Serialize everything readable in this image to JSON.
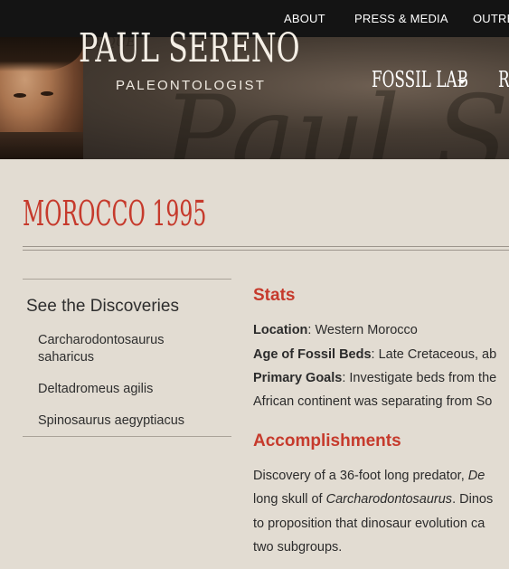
{
  "topnav": {
    "items": [
      "ABOUT",
      "PRESS & MEDIA",
      "OUTRE"
    ]
  },
  "header": {
    "site_name": "PAUL SERENO",
    "site_subtitle": "PALEONTOLOGIST",
    "nav_fossil_lab": "FOSSIL LAB",
    "nav_next_partial": "RI"
  },
  "page": {
    "title": "MOROCCO 1995"
  },
  "sidebar": {
    "heading": "See the Discoveries",
    "items": [
      "Carcharodontosaurus saharicus",
      "Deltadromeus agilis",
      "Spinosaurus aegyptiacus"
    ]
  },
  "stats": {
    "heading": "Stats",
    "location_label": "Location",
    "location_value": ": Western Morocco",
    "age_label": "Age of Fossil Beds",
    "age_value": ": Late Cretaceous, ab",
    "goals_label": "Primary Goals",
    "goals_value": ": Investigate beds from the",
    "goals_line2": "African continent was separating from So"
  },
  "accomplishments": {
    "heading": "Accomplishments",
    "line1_pre": "Discovery of a 36-foot long predator, ",
    "line1_italic": "De",
    "line2_pre": "long skull of ",
    "line2_italic": "Carcharodontosaurus",
    "line2_post": ". Dinos",
    "line3": "to proposition that dinosaur evolution ca",
    "line4": "two subgroups."
  },
  "colors": {
    "accent_red": "#c63a2c",
    "topbar": "#141414",
    "page_bg": "#e2dcd2"
  }
}
